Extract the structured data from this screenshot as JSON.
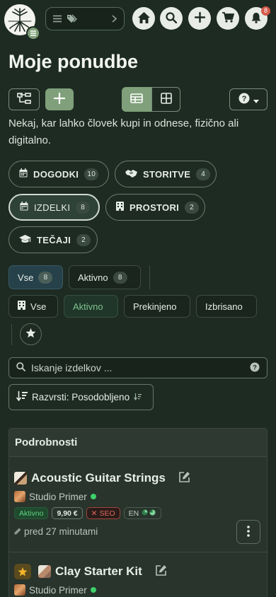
{
  "header": {
    "logo": "tree-logo",
    "menu_icon": "menu-icon",
    "notification_count": "8"
  },
  "page": {
    "title": "Moje ponudbe",
    "description": "Nekaj, kar lahko človek kupi in odnese, fizično ali digitalno."
  },
  "categories": [
    {
      "label": "DOGODKI",
      "count": "10"
    },
    {
      "label": "STORITVE",
      "count": "4"
    },
    {
      "label": "IZDELKI",
      "count": "8"
    },
    {
      "label": "PROSTORI",
      "count": "2"
    },
    {
      "label": "TEČAJI",
      "count": "2"
    }
  ],
  "filters": {
    "all_label": "Vse",
    "all_count": "8",
    "active_label": "Aktivno",
    "active_count": "8",
    "status_all": "Vse",
    "status_active": "Aktivno",
    "status_paused": "Prekinjeno",
    "status_deleted": "Izbrisano"
  },
  "search": {
    "placeholder": "Iskanje izdelkov ..."
  },
  "sort": {
    "label": "Razvrsti: Posodobljeno"
  },
  "panel": {
    "title": "Podrobnosti"
  },
  "items": [
    {
      "title": "Acoustic Guitar Strings",
      "studio": "Studio Primer",
      "status": "Aktivno",
      "price": "9,90 €",
      "seo": "SEO",
      "lang": "EN",
      "updated": "pred 27 minutami"
    },
    {
      "title": "Clay Starter Kit",
      "studio": "Studio Primer"
    }
  ],
  "colors": {
    "background": "#1e2b22",
    "accent_green": "#7fa07a",
    "status_green": "#7fc48e",
    "seo_red": "#e0675a"
  }
}
